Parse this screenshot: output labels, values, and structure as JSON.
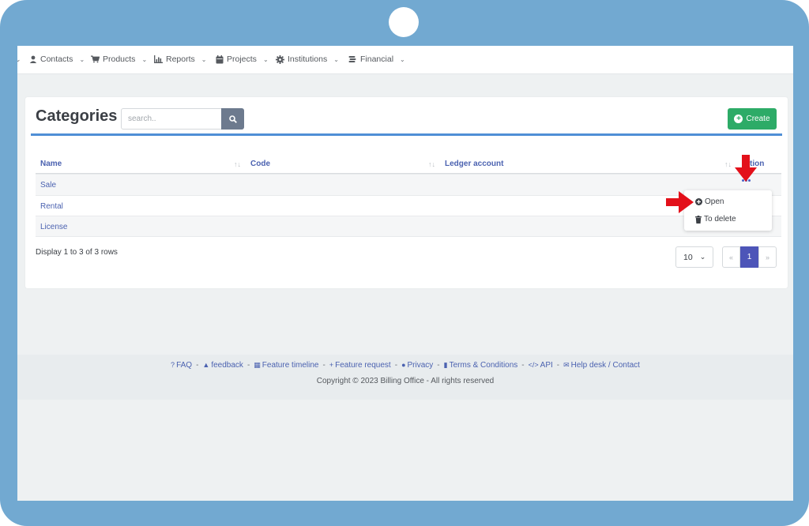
{
  "nav": {
    "items": [
      {
        "label": "Contacts",
        "icon": "user-icon"
      },
      {
        "label": "Products",
        "icon": "cart-icon"
      },
      {
        "label": "Reports",
        "icon": "chart-icon"
      },
      {
        "label": "Projects",
        "icon": "calendar-icon"
      },
      {
        "label": "Institutions",
        "icon": "gear-icon"
      },
      {
        "label": "Financial",
        "icon": "coins-icon"
      }
    ]
  },
  "page": {
    "title": "Categories",
    "search_placeholder": "search..",
    "create_label": "Create"
  },
  "table": {
    "columns": [
      "Name",
      "Code",
      "Ledger account",
      "Action"
    ],
    "action_partial": "tion",
    "rows": [
      {
        "name": "Sale"
      },
      {
        "name": "Rental"
      },
      {
        "name": "License"
      }
    ]
  },
  "dropdown": {
    "open_label": "Open",
    "delete_label": "To delete"
  },
  "pagination": {
    "info": "Display 1 to 3 of 3 rows",
    "per_page": "10",
    "prev": "«",
    "current": "1",
    "next": "»"
  },
  "footer": {
    "links": [
      {
        "label": "FAQ",
        "icon": "question-icon"
      },
      {
        "label": "feedback",
        "icon": "megaphone-icon"
      },
      {
        "label": "Feature timeline",
        "icon": "timeline-icon"
      },
      {
        "label": "Feature request",
        "icon": "plus-icon"
      },
      {
        "label": "Privacy",
        "icon": "users-icon"
      },
      {
        "label": "Terms & Conditions",
        "icon": "file-icon"
      },
      {
        "label": "API",
        "icon": "code-icon"
      },
      {
        "label": "Help desk / Contact",
        "icon": "envelope-icon"
      }
    ],
    "copyright": "Copyright © 2023 Billing Office - All rights reserved"
  },
  "colors": {
    "frame": "#72a9d1",
    "accent": "#4f8fd6",
    "create": "#2dab67",
    "link": "#4b62b0",
    "pager_active": "#4d55b8",
    "arrow": "#e3101a"
  }
}
